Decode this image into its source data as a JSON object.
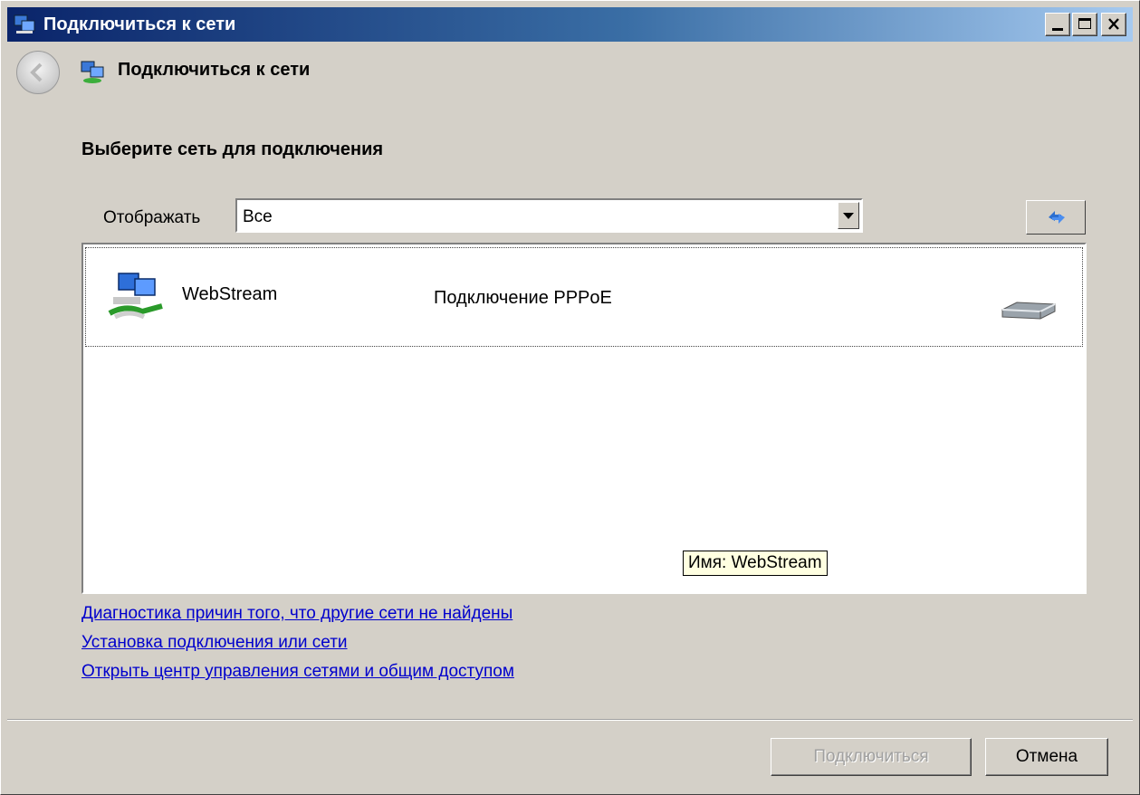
{
  "window": {
    "title": "Подключиться к сети"
  },
  "header": {
    "title": "Подключиться к сети"
  },
  "main": {
    "subtitle": "Выберите сеть для подключения",
    "show_label": "Отображать",
    "show_value": "Все",
    "networks": [
      {
        "name": "WebStream",
        "type": "Подключение PPPoE",
        "icon": "dialup-network-icon",
        "signal_icon": "modem-icon"
      }
    ],
    "tooltip": "Имя: WebStream",
    "links": [
      "Диагностика причин того, что другие сети не найдены",
      "Установка подключения или сети",
      "Открыть центр управления сетями и общим доступом"
    ]
  },
  "footer": {
    "connect_label": "Подключиться",
    "cancel_label": "Отмена"
  }
}
